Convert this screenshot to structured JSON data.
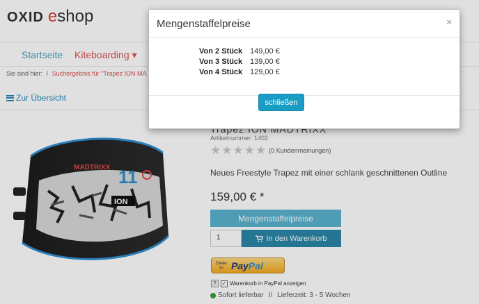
{
  "header": {
    "logo_oxid": "OXID",
    "logo_e": "e",
    "logo_shop": "shop"
  },
  "nav": {
    "items": [
      {
        "label": "Startseite"
      },
      {
        "label": "Kiteboarding ▾"
      }
    ]
  },
  "breadcrumb": {
    "prefix": "Sie sind hier:",
    "separator": "/",
    "link": "Suchergebnis für \"Trapez ION MA"
  },
  "back_link": {
    "label": "Zur Übersicht",
    "icon": "bars-icon"
  },
  "product": {
    "title_partial": "Trapez ION MADTRIXX",
    "article_number": "Artikelnummer: 1402",
    "rating_stars": 0,
    "rating_max": 5,
    "reviews": "(0 Kundenmeinungen)",
    "description": "Neues Freestyle Trapez mit einer schlank geschnittenen Outline",
    "price": "159,00 € *",
    "staffel_button": "Mengenstaffelpreise",
    "quantity": "1",
    "cart_button": "In den Warenkorb",
    "cart_icon": "cart-icon",
    "image_text": "MADTRIXX 11 ION"
  },
  "paypal": {
    "direkt_line1": "Direkt",
    "direkt_line2": "zu",
    "logo_pay": "Pay",
    "logo_pal": "Pal",
    "qmark": "?",
    "checkbox_label": "Warenkorb in PayPal anzeigen",
    "checked": true
  },
  "stock": {
    "status": "Sofort lieferbar",
    "separator": "//",
    "delivery": "Lieferzeit: 3 - 5 Wochen",
    "color": "#3c9a3c"
  },
  "modal": {
    "title": "Mengenstaffelpreise",
    "close_symbol": "×",
    "prices": [
      {
        "label": "Von 2 Stück",
        "value": "149,00 €"
      },
      {
        "label": "Von 3 Stück",
        "value": "139,00 €"
      },
      {
        "label": "Von 4 Stück",
        "value": "129,00 €"
      }
    ],
    "close_button": "schließen"
  },
  "colors": {
    "accent": "#1a9dc4",
    "brand_red": "#d73b2f",
    "link_blue": "#2a87b5"
  }
}
